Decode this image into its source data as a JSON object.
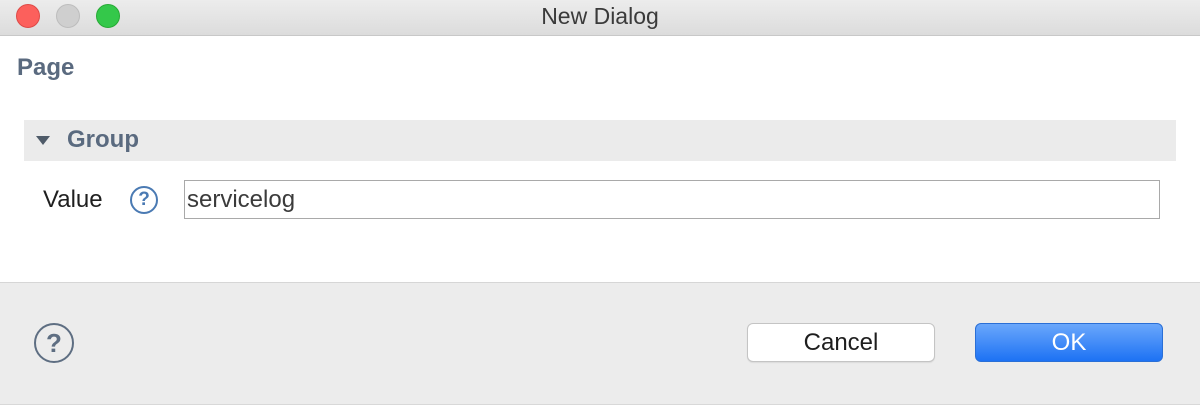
{
  "window": {
    "title": "New Dialog"
  },
  "page": {
    "title": "Page"
  },
  "group": {
    "label": "Group",
    "expanded": true
  },
  "field": {
    "label": "Value",
    "value": "servicelog",
    "help_glyph": "?"
  },
  "footer": {
    "help_glyph": "?",
    "cancel_label": "Cancel",
    "ok_label": "OK"
  },
  "colors": {
    "accent": "#1d72f4",
    "section_text": "#5a6a7f",
    "close": "#fc605c",
    "zoom": "#34c84a"
  },
  "icons": [
    "close-icon",
    "minimize-icon",
    "zoom-icon",
    "disclosure-triangle-icon",
    "help-icon"
  ]
}
